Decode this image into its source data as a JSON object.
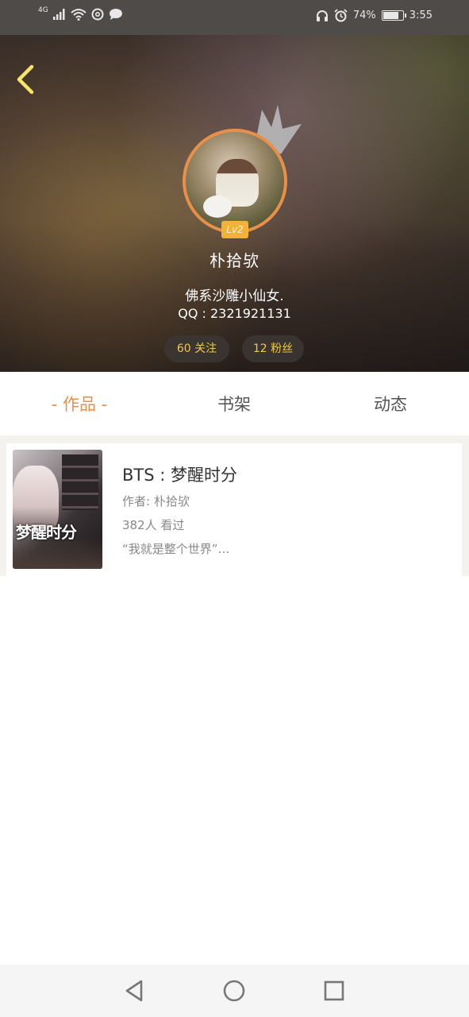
{
  "status_bar": {
    "network": "4G",
    "battery_percent": "74%",
    "time": "3:55",
    "icons": [
      "signal-icon",
      "wifi-icon",
      "netease-music-icon",
      "message-icon",
      "headphones-icon",
      "alarm-icon",
      "battery-icon"
    ]
  },
  "profile": {
    "back_icon": "chevron-left-icon",
    "level": "Lv2",
    "nickname": "朴拾欤",
    "signature": "佛系沙雕小仙女.",
    "qq": "QQ : 2321921131",
    "following": "60 关注",
    "fans": "12 粉丝"
  },
  "tabs": [
    {
      "label": "- 作品 -",
      "active": true
    },
    {
      "label": "书架",
      "active": false
    },
    {
      "label": "动态",
      "active": false
    }
  ],
  "works": [
    {
      "cover_text": "梦醒时分",
      "title": "BTS : 梦醒时分",
      "author": "作者: 朴拾欤",
      "views": "382人 看过",
      "intro": "“我就是整个世界”…"
    }
  ],
  "colors": {
    "accent": "#e8904a",
    "badge": "#f2b23a",
    "pill_text": "#f0c94a"
  },
  "nav_bar": {
    "icons": [
      "back-triangle-icon",
      "home-circle-icon",
      "recents-square-icon"
    ]
  }
}
